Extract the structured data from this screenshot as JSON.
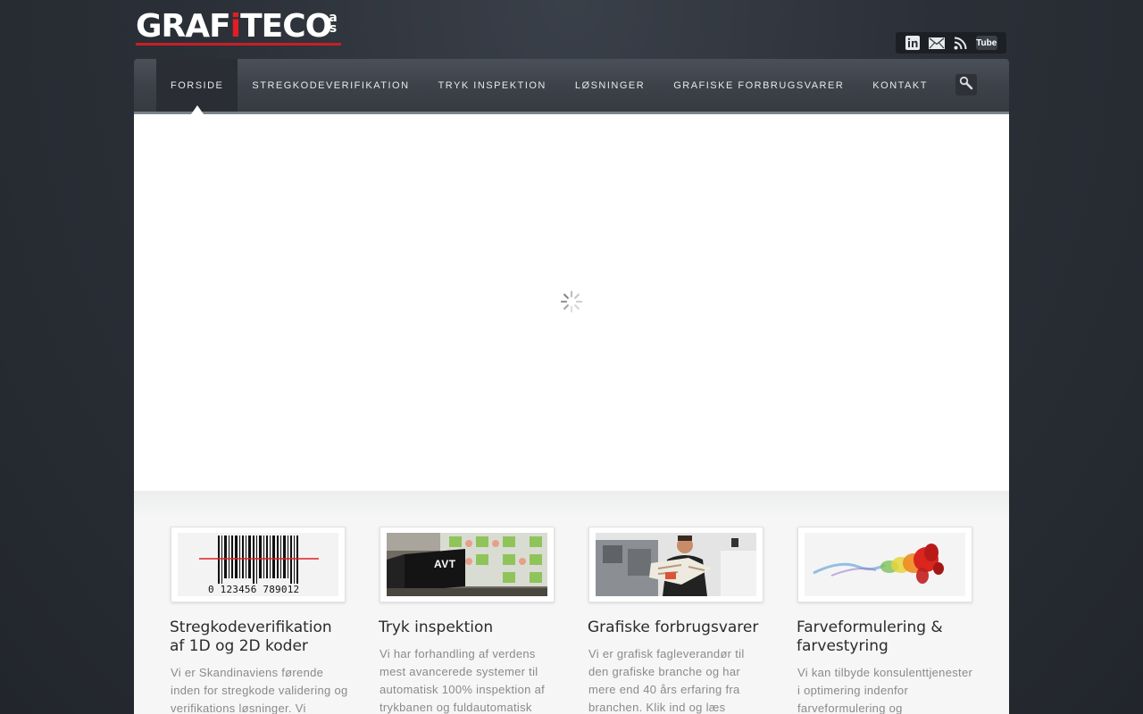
{
  "header": {
    "logo": {
      "text": "GRAFiTECO",
      "suffix": "as"
    },
    "social": {
      "linkedin_icon": "linkedin-icon",
      "email_icon": "email-icon",
      "rss_icon": "rss-icon",
      "youtube_label": "Tube"
    }
  },
  "nav": {
    "items": [
      {
        "label": "FORSIDE"
      },
      {
        "label": "STREGKODEVERIFIKATION"
      },
      {
        "label": "TRYK INSPEKTION"
      },
      {
        "label": "LØSNINGER"
      },
      {
        "label": "GRAFISKE FORBRUGSVARER"
      },
      {
        "label": "KONTAKT"
      }
    ],
    "active_index": 0,
    "search_icon": "search-icon"
  },
  "slider": {
    "loading_icon": "spinner-icon"
  },
  "features": [
    {
      "title": "Stregkodeverifikation af 1D og 2D koder",
      "text": "Vi er Skandinaviens førende inden for stregkode validering og verifikations løsninger. Vi",
      "image_icon": "barcode-image",
      "barcode_digits": "0 123456 789012"
    },
    {
      "title": "Tryk inspektion",
      "text": "Vi har forhandling af verdens mest avancerede systemer til automatisk 100% inspektion af trykbanen og fuldautomatisk",
      "image_icon": "press-inspection-image",
      "brand": "AVT"
    },
    {
      "title": "Grafiske forbrugsvarer",
      "text": "Vi er grafisk fagleverandør til den grafiske branche og har mere end 40 års erfaring fra branchen. Klik ind og læs",
      "image_icon": "printer-operator-image"
    },
    {
      "title": "Farveformulering & farvestyring",
      "text": "Vi kan tilbyde konsulenttjenester i optimering indenfor farveformulering og",
      "image_icon": "color-ink-image"
    }
  ],
  "colors": {
    "brand_red": "#e01e26",
    "nav_bg": "#3d424a",
    "page_bg": "#2b3038"
  }
}
